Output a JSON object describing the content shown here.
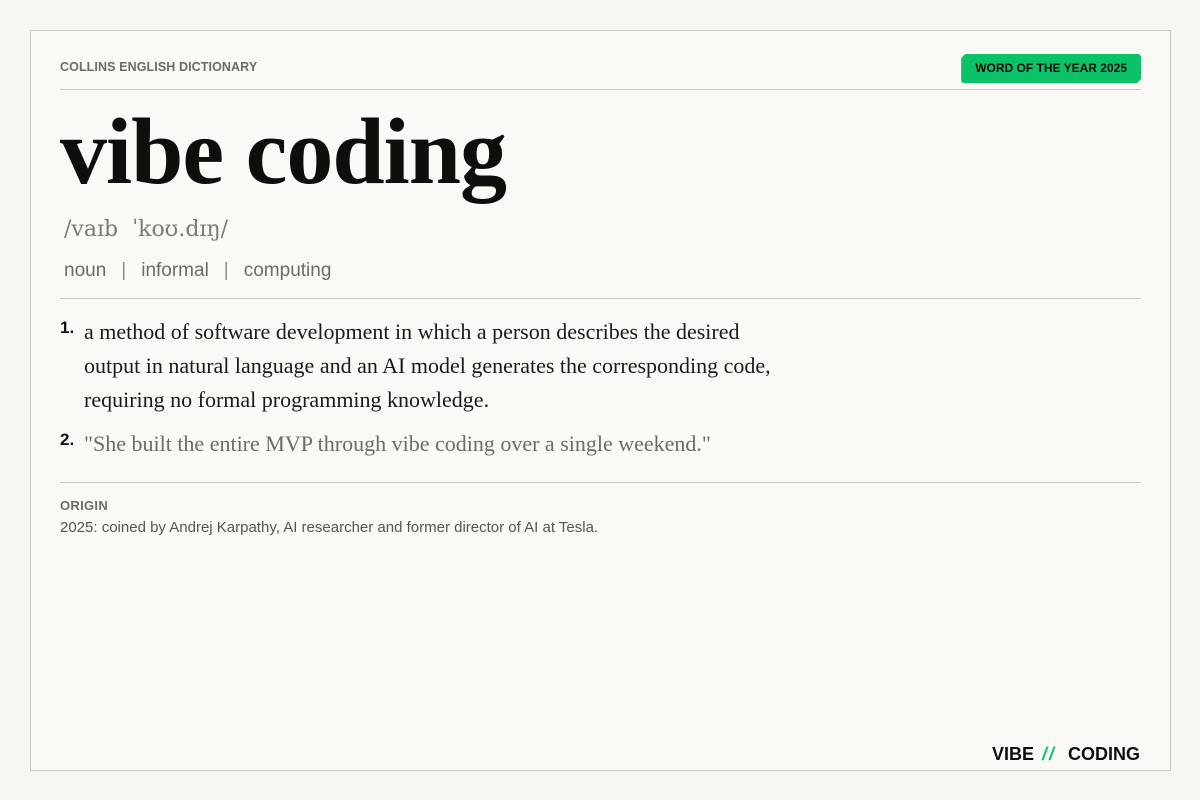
{
  "header": {
    "publisher": "COLLINS ENGLISH DICTIONARY",
    "badge": "WORD OF THE YEAR 2025"
  },
  "entry": {
    "headword": "vibe coding",
    "pronunciation": "/vaɪb  ˈkoʊ.dɪŋ/",
    "parts_of_speech": [
      "noun",
      "informal",
      "computing"
    ],
    "separator": "|",
    "senses": [
      {
        "number": "1.",
        "text": "a method of software development in which a person describes the desired output in natural language and an AI model generates the corresponding code, requiring no formal programming knowledge."
      },
      {
        "number": "2.",
        "text": "\"She built the entire MVP through vibe coding over a single weekend.\""
      }
    ]
  },
  "origin": {
    "label": "ORIGIN",
    "text": "2025: coined by Andrej Karpathy, AI researcher and former director of AI at Tesla."
  },
  "brand": {
    "left": "VIBE",
    "divider": "//",
    "right": "CODING"
  },
  "colors": {
    "accent": "#0cc268",
    "background": "#faf9f5",
    "text": "#0e0e0e",
    "muted": "#6b6b68"
  }
}
